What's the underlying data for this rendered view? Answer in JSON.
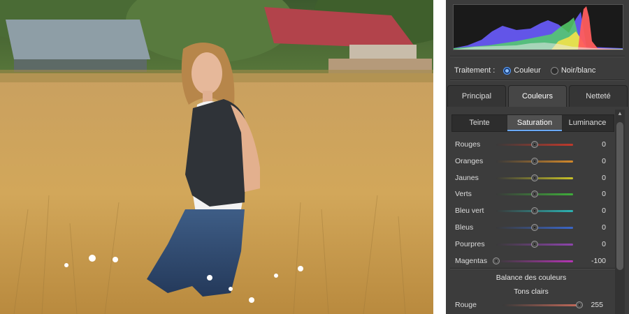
{
  "panel": {
    "treatment": {
      "label": "Traitement :",
      "options": [
        {
          "label": "Couleur",
          "selected": true
        },
        {
          "label": "Noir/blanc",
          "selected": false
        }
      ]
    },
    "tabs": [
      {
        "label": "Principal",
        "active": false
      },
      {
        "label": "Couleurs",
        "active": true
      },
      {
        "label": "Netteté",
        "active": false
      }
    ],
    "subtabs": [
      {
        "label": "Teinte",
        "active": false
      },
      {
        "label": "Saturation",
        "active": true
      },
      {
        "label": "Luminance",
        "active": false
      }
    ],
    "sliders": [
      {
        "label": "Rouges",
        "value": "0",
        "level": 0.5,
        "color": "#c0392b"
      },
      {
        "label": "Oranges",
        "value": "0",
        "level": 0.5,
        "color": "#d4892a"
      },
      {
        "label": "Jaunes",
        "value": "0",
        "level": 0.5,
        "color": "#c9c227"
      },
      {
        "label": "Verts",
        "value": "0",
        "level": 0.5,
        "color": "#3fae3a"
      },
      {
        "label": "Bleu vert",
        "value": "0",
        "level": 0.5,
        "color": "#2bb3b3"
      },
      {
        "label": "Bleus",
        "value": "0",
        "level": 0.5,
        "color": "#3a66c9"
      },
      {
        "label": "Pourpres",
        "value": "0",
        "level": 0.5,
        "color": "#8e44ad"
      },
      {
        "label": "Magentas",
        "value": "-100",
        "level": 0.0,
        "color": "#b535b5"
      }
    ],
    "balance": {
      "title": "Balance des couleurs",
      "section": "Tons clairs",
      "slider": {
        "label": "Rouge",
        "value": "255",
        "level": 1.0,
        "color": "#c46a5a"
      }
    }
  }
}
